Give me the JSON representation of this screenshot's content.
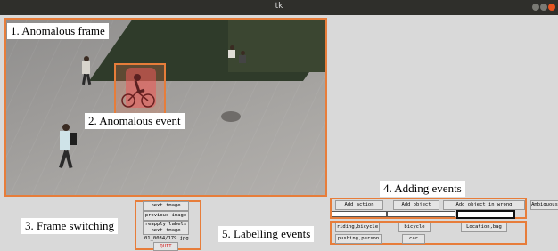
{
  "window": {
    "title": "tk"
  },
  "annotations": {
    "anomalous_frame": "1. Anomalous frame",
    "anomalous_event": "2. Anomalous event",
    "frame_switching": "3. Frame switching",
    "adding_events": "4. Adding events",
    "labelling_events": "5. Labelling events"
  },
  "frame_switching": {
    "next_image": "next image",
    "previous_image": "previous image",
    "reapply_labels": "reapply labels",
    "reapply_labels_next": "next image",
    "filename": "01_0034/179.jpg",
    "quit": "QUIT"
  },
  "adding_events": {
    "add_action": "Add action",
    "add_object": "Add object",
    "add_object_wrong_location": "Add object in wrong location",
    "ambiguous": "Ambiguous"
  },
  "labels": [
    "riding,bicycle",
    "bicycle",
    "Location,bag",
    "pushing,person",
    "car"
  ],
  "colors": {
    "annotation_border": "#e77d3a",
    "quit_text": "#d31a1a",
    "titlebar": "#2f2f2b"
  },
  "icons": [
    "minimize-icon",
    "maximize-icon",
    "close-icon"
  ]
}
